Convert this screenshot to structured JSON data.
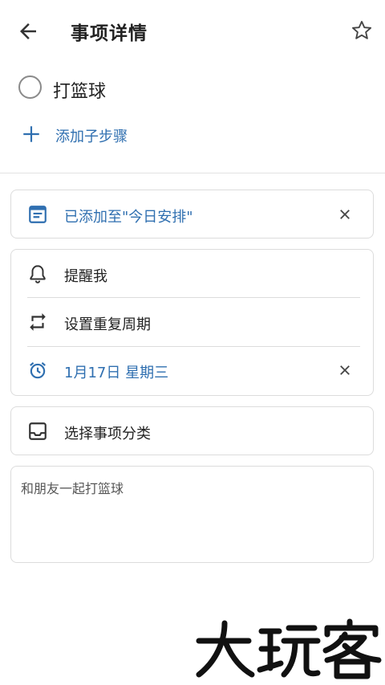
{
  "header": {
    "title": "事项详情",
    "back_icon": "arrow-left-icon",
    "favorite_icon": "star-outline-icon"
  },
  "task": {
    "title": "打篮球",
    "completed": false
  },
  "add_step": {
    "label": "添加子步骤",
    "icon": "plus-icon"
  },
  "my_day_card": {
    "label": "已添加至\"今日安排\"",
    "icon": "calendar-note-icon"
  },
  "options_card": {
    "reminder_label": "提醒我",
    "repeat_label": "设置重复周期",
    "due_date_label": "1月17日 星期三"
  },
  "category_card": {
    "label": "选择事项分类",
    "icon": "inbox-icon"
  },
  "note": {
    "text": "和朋友一起打篮球"
  },
  "watermark": {
    "text": "大玩客"
  },
  "colors": {
    "accent": "#2f6fb0",
    "text": "#222222",
    "border": "#dcdcdc"
  }
}
